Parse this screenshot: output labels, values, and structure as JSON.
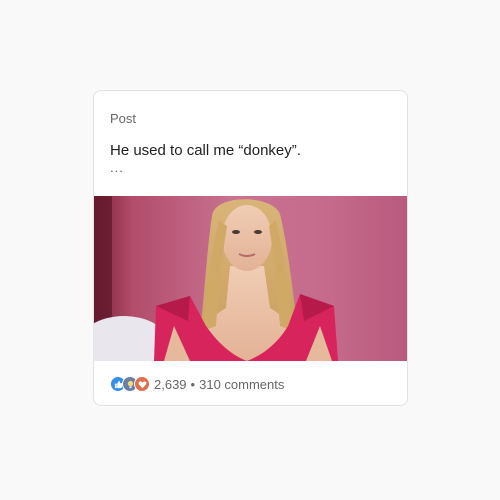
{
  "post": {
    "kicker": "Post",
    "title": "He used to call me “donkey”.",
    "more": "...",
    "image_alt": "Woman with long blonde hair in a pink dress against a pink background"
  },
  "engagement": {
    "reaction_icons": [
      "like-icon",
      "insightful-icon",
      "love-icon"
    ],
    "reaction_count": "2,639",
    "separator": "•",
    "comments": "310 comments"
  },
  "colors": {
    "like": "#378fe9",
    "insightful": "#6b7fa6",
    "love": "#df704d",
    "background_pink": "#c76a8a",
    "dress_pink": "#d8245c"
  }
}
